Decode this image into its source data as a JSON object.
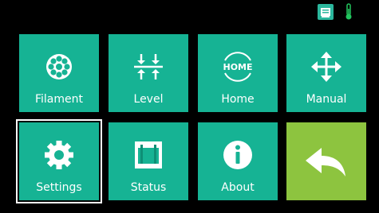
{
  "status_bar": {
    "sd_icon": "sd-card-icon",
    "thermo_icon": "thermometer-icon",
    "sd_color": "#2bb79d",
    "thermo_color": "#22c55e"
  },
  "colors": {
    "tile": "#16b394",
    "back_tile": "#8dc43f",
    "background": "#000000",
    "selection_border": "#ffffff"
  },
  "menu": {
    "filament": {
      "label": "Filament",
      "icon": "filament-spool-icon"
    },
    "level": {
      "label": "Level",
      "icon": "level-arrows-icon"
    },
    "home": {
      "label": "Home",
      "icon_text": "HOME",
      "icon": "home-icon"
    },
    "manual": {
      "label": "Manual",
      "icon": "move-arrows-icon"
    },
    "settings": {
      "label": "Settings",
      "icon": "gear-icon",
      "selected": true
    },
    "status": {
      "label": "Status",
      "icon": "printer-status-icon"
    },
    "about": {
      "label": "About",
      "icon": "info-icon"
    },
    "back": {
      "icon": "back-arrow-icon"
    }
  }
}
